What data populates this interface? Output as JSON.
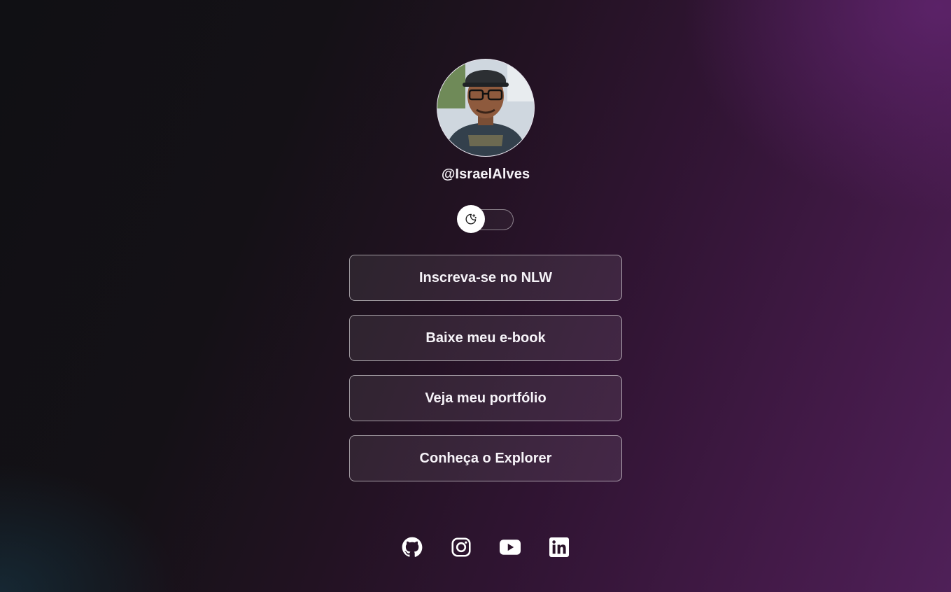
{
  "profile": {
    "handle": "@IsraelAlves"
  },
  "theme_switch": {
    "icon": "moon-stars-icon",
    "state": "dark"
  },
  "links": [
    {
      "label": "Inscreva-se no NLW"
    },
    {
      "label": "Baixe meu e-book"
    },
    {
      "label": "Veja meu portfólio"
    },
    {
      "label": "Conheça o Explorer"
    }
  ],
  "social": [
    {
      "icon": "github-icon"
    },
    {
      "icon": "instagram-icon"
    },
    {
      "icon": "youtube-icon"
    },
    {
      "icon": "linkedin-icon"
    }
  ],
  "colors": {
    "text": "#f4f0f6",
    "accent_purple": "#4f2058",
    "button_border": "#ffffff"
  }
}
